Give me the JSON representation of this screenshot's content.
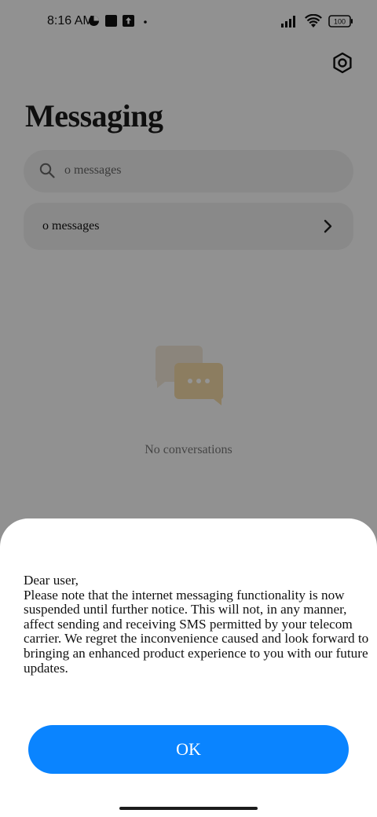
{
  "status_bar": {
    "time": "8:16 AM",
    "battery": "100"
  },
  "app": {
    "title": "Messaging",
    "search_placeholder": "o messages",
    "row_label": "o messages",
    "empty_text": "No conversations"
  },
  "dialog": {
    "message": "Dear user,\nPlease note that the internet messaging functionality is now suspended until further notice. This will not, in any manner, affect sending and receiving SMS permitted by your telecom carrier. We regret the inconvenience caused and look forward to bringing an enhanced product experience to you with our future updates.",
    "ok_label": "OK",
    "ok_color": "#0a84ff"
  }
}
